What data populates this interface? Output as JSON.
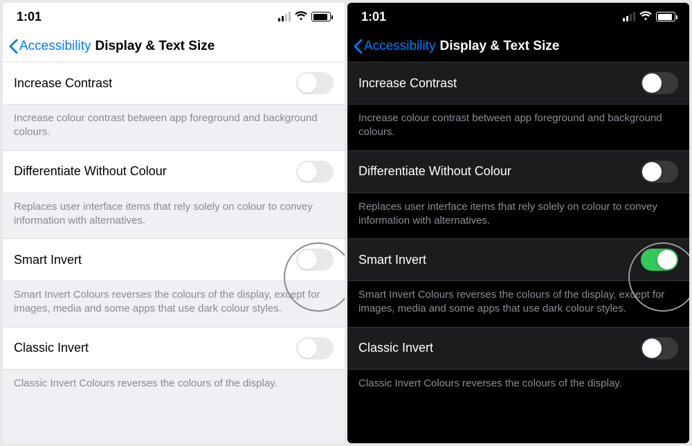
{
  "status": {
    "time": "1:01"
  },
  "nav": {
    "back_label": "Accessibility",
    "title": "Display & Text Size"
  },
  "rows": {
    "increase_contrast": {
      "title": "Increase Contrast",
      "desc": "Increase colour contrast between app foreground and background colours."
    },
    "differentiate": {
      "title": "Differentiate Without Colour",
      "desc": "Replaces user interface items that rely solely on colour to convey information with alternatives."
    },
    "smart_invert": {
      "title": "Smart Invert",
      "desc_light": "Smart Invert Colours reverses the colours of the display, except for images, media and some apps that use dark colour styles.",
      "desc_dark": "Smart Invert Colours reverses the colours of the display, except for images, media and some apps that use dark colour styles."
    },
    "classic_invert": {
      "title": "Classic Invert",
      "desc": "Classic Invert Colours reverses the colours of the display."
    }
  },
  "toggles": {
    "light": {
      "increase_contrast": false,
      "differentiate": false,
      "smart_invert": false,
      "classic_invert": false
    },
    "dark": {
      "increase_contrast": false,
      "differentiate": false,
      "smart_invert": true,
      "classic_invert": false
    }
  }
}
